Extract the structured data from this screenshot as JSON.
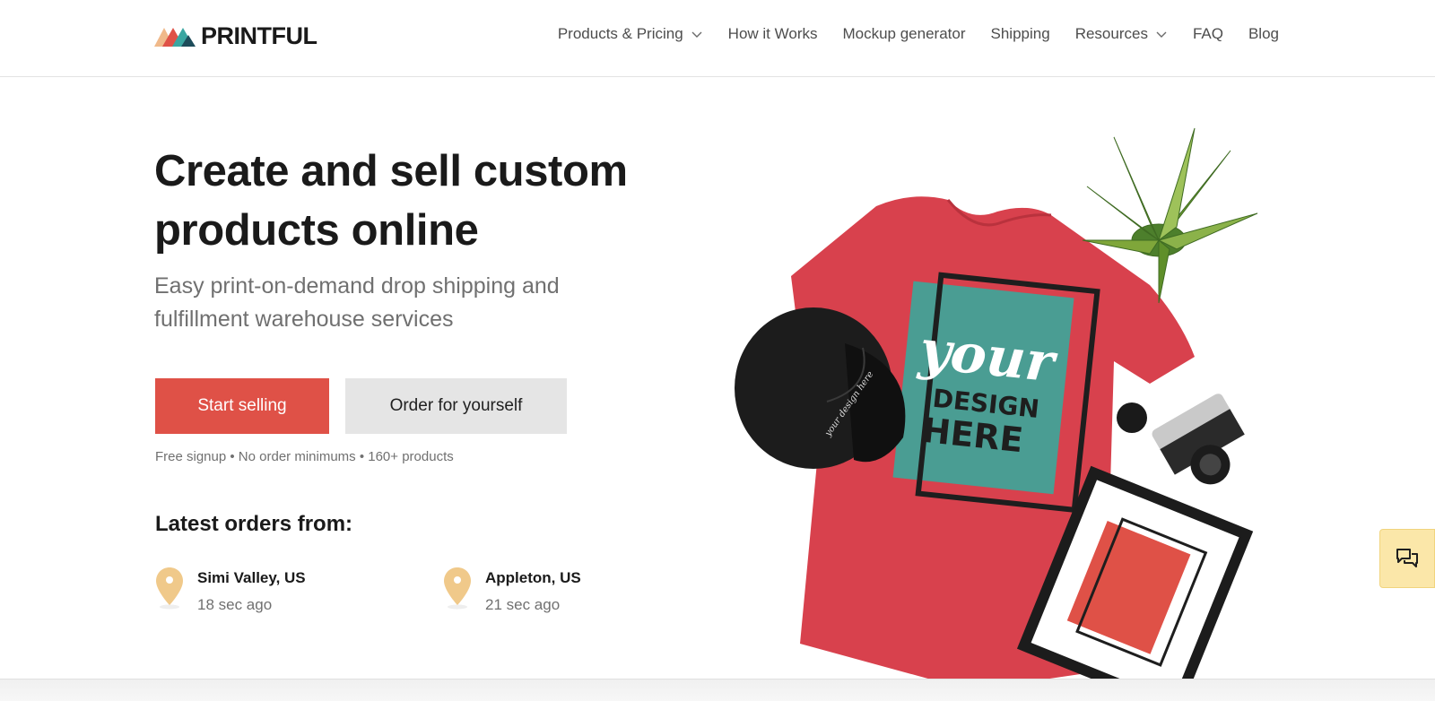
{
  "brand": {
    "name": "PRINTFUL",
    "colors": [
      "#f0b98a",
      "#df5147",
      "#3aa6a1",
      "#1d4c5a"
    ]
  },
  "nav": {
    "items": [
      {
        "label": "Products & Pricing",
        "dropdown": true
      },
      {
        "label": "How it Works",
        "dropdown": false
      },
      {
        "label": "Mockup generator",
        "dropdown": false
      },
      {
        "label": "Shipping",
        "dropdown": false
      },
      {
        "label": "Resources",
        "dropdown": true
      },
      {
        "label": "FAQ",
        "dropdown": false
      },
      {
        "label": "Blog",
        "dropdown": false
      }
    ]
  },
  "hero": {
    "title_line1": "Create and sell custom",
    "title_line2": "products online",
    "subtitle_line1": "Easy print-on-demand drop shipping and",
    "subtitle_line2": "fulfillment warehouse services",
    "primary_button": "Start selling",
    "secondary_button": "Order for yourself",
    "perks": "Free signup • No order minimums • 160+ products",
    "image": {
      "shirt_color": "#d8414d",
      "print_bg": "#4a9d93",
      "text_your": "your",
      "text_design": "DESIGN",
      "text_here": "HERE",
      "hat_text": "your design here"
    }
  },
  "latest_orders": {
    "title": "Latest orders from:",
    "items": [
      {
        "city": "Simi Valley, US",
        "time": "18 sec ago"
      },
      {
        "city": "Appleton, US",
        "time": "21 sec ago"
      }
    ]
  },
  "colors": {
    "accent": "#df5147",
    "pin": "#f0c98a",
    "chat_bg": "#fbe7a9"
  },
  "chat": {
    "icon": "chat-bubbles-icon"
  }
}
